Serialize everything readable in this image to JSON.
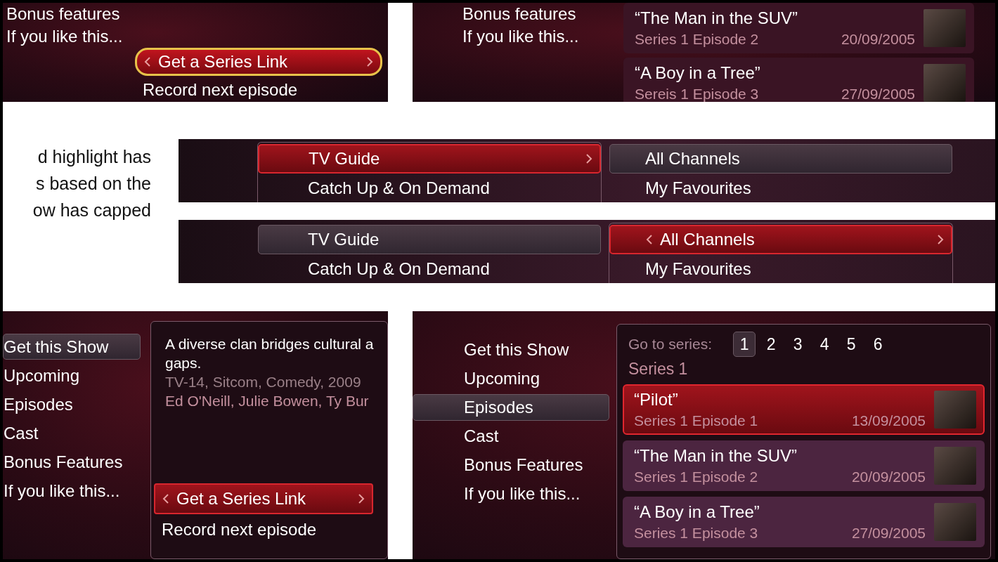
{
  "top_left": {
    "outlined": true,
    "menu": {
      "items": [
        {
          "label": "Bonus features",
          "selected": false
        },
        {
          "label": "If you like this...",
          "selected": false
        }
      ]
    },
    "actions": {
      "focused": true,
      "prev_arrow": true,
      "next_arrow": true,
      "items": [
        {
          "label": "Get a Series Link",
          "selected": true
        },
        {
          "label": "Record next episode",
          "selected": false
        }
      ]
    }
  },
  "top_right": {
    "menu": {
      "items": [
        {
          "label": "Bonus features",
          "selected": false
        },
        {
          "label": "If you like this...",
          "selected": false
        }
      ]
    },
    "episodes": [
      {
        "title": "“The Man in the SUV”",
        "subtitle": "Series 1 Episode 2",
        "date": "20/09/2005",
        "selected": false
      },
      {
        "title": "“A Boy in a Tree”",
        "subtitle": "Sereis 1 Episode 3",
        "date": "27/09/2005",
        "selected": false
      }
    ]
  },
  "note": {
    "lines": [
      "d highlight has",
      "s based on the",
      "ow has capped"
    ]
  },
  "strips": [
    {
      "columns": [
        {
          "focused": true,
          "prev_arrow": false,
          "next_arrow": true,
          "items": [
            {
              "label": "TV Guide",
              "selected": true
            },
            {
              "label": "Catch Up & On Demand",
              "selected": false
            }
          ]
        },
        {
          "focused": false,
          "items": [
            {
              "label": "All Channels",
              "selected": true
            },
            {
              "label": "My Favourites",
              "selected": false
            }
          ]
        }
      ]
    },
    {
      "columns": [
        {
          "focused": false,
          "items": [
            {
              "label": "TV Guide",
              "selected": true
            },
            {
              "label": "Catch Up & On Demand",
              "selected": false
            }
          ]
        },
        {
          "focused": true,
          "prev_arrow": true,
          "next_arrow": true,
          "items": [
            {
              "label": "All Channels",
              "selected": true
            },
            {
              "label": "My Favourites",
              "selected": false
            }
          ]
        }
      ]
    }
  ],
  "bottom_left": {
    "outlined": false,
    "menu": {
      "focused": false,
      "items": [
        {
          "label": "Get this Show",
          "selected": true
        },
        {
          "label": "Upcoming",
          "selected": false
        },
        {
          "label": "Episodes",
          "selected": false
        },
        {
          "label": "Cast",
          "selected": false
        },
        {
          "label": "Bonus Features",
          "selected": false
        },
        {
          "label": "If you like this...",
          "selected": false
        }
      ]
    },
    "description": {
      "summary_lines": [
        "A diverse clan bridges cultural a",
        "gaps."
      ],
      "info": "TV-14, Sitcom, Comedy, 2009",
      "cast": "Ed O'Neill, Julie Bowen, Ty Bur"
    },
    "actions": {
      "focused": true,
      "prev_arrow": true,
      "next_arrow": true,
      "items": [
        {
          "label": "Get a Series Link",
          "selected": true
        },
        {
          "label": "Record next episode",
          "selected": false
        }
      ]
    }
  },
  "bottom_right": {
    "menu": {
      "focused": false,
      "items": [
        {
          "label": "Get this Show",
          "selected": false
        },
        {
          "label": "Upcoming",
          "selected": false
        },
        {
          "label": "Episodes",
          "selected": true
        },
        {
          "label": "Cast",
          "selected": false
        },
        {
          "label": "Bonus Features",
          "selected": false
        },
        {
          "label": "If you like this...",
          "selected": false
        }
      ]
    },
    "series": {
      "label": "Go to series:",
      "tabs": [
        {
          "label": "1",
          "selected": true
        },
        {
          "label": "2",
          "selected": false
        },
        {
          "label": "3",
          "selected": false
        },
        {
          "label": "4",
          "selected": false
        },
        {
          "label": "5",
          "selected": false
        },
        {
          "label": "6",
          "selected": false
        }
      ],
      "heading": "Series 1"
    },
    "episodes": [
      {
        "title": "“Pilot”",
        "subtitle": "Series 1 Episode 1",
        "date": "13/09/2005",
        "selected": true
      },
      {
        "title": "“The Man in the SUV”",
        "subtitle": "Series 1 Episode 2",
        "date": "20/09/2005",
        "selected": false
      },
      {
        "title": "“A Boy in a Tree”",
        "subtitle": "Series 1 Episode 3",
        "date": "27/09/2005",
        "selected": false
      }
    ]
  }
}
